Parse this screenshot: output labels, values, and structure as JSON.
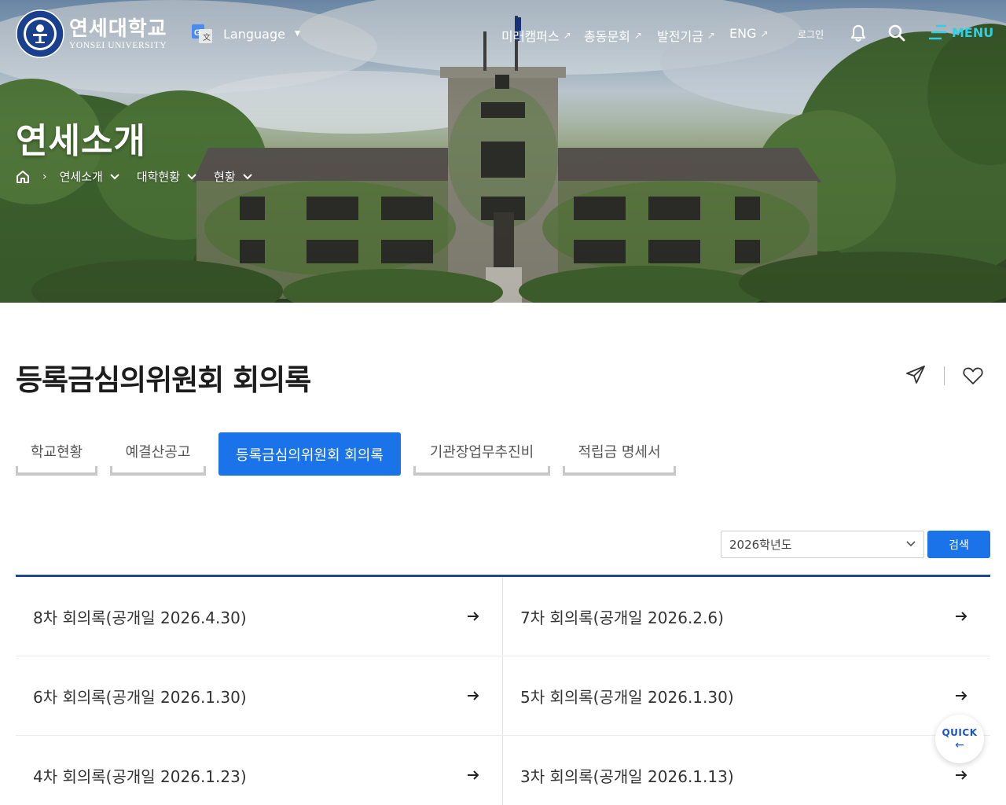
{
  "header": {
    "logo_ko": "연세대학교",
    "logo_en": "YONSEI UNIVERSITY",
    "emblem_ring_text": "YONSEI UNIVERSITY",
    "language_label": "Language",
    "util_links": [
      {
        "label": "미래캠퍼스"
      },
      {
        "label": "총동문회"
      },
      {
        "label": "발전기금"
      },
      {
        "label": "ENG"
      }
    ],
    "login_label": "로그인",
    "menu_label": "MENU"
  },
  "hero": {
    "title": "연세소개",
    "breadcrumb": [
      "연세소개",
      "대학현황",
      "현황"
    ]
  },
  "content": {
    "title": "등록금심의위원회 회의록",
    "tabs": [
      {
        "label": "학교현황",
        "active": false
      },
      {
        "label": "예결산공고",
        "active": false
      },
      {
        "label": "등록금심의위원회 회의록",
        "active": true
      },
      {
        "label": "기관장업무추진비",
        "active": false
      },
      {
        "label": "적립금 명세서",
        "active": false
      }
    ],
    "filter": {
      "selected": "2026학년도",
      "search_label": "검색"
    },
    "minutes": [
      "8차 회의록(공개일 2026.4.30)",
      "7차 회의록(공개일 2026.2.6)",
      "6차 회의록(공개일 2026.1.30)",
      "5차 회의록(공개일 2026.1.30)",
      "4차 회의록(공개일 2026.1.23)",
      "3차 회의록(공개일 2026.1.13)"
    ]
  },
  "quick": {
    "label": "QUICK",
    "arrow": "←"
  },
  "colors": {
    "accent": "#1a73e8",
    "list_border": "#1e4a8c",
    "menu": "#2fd0e3",
    "quick_text": "#1a56c4"
  }
}
